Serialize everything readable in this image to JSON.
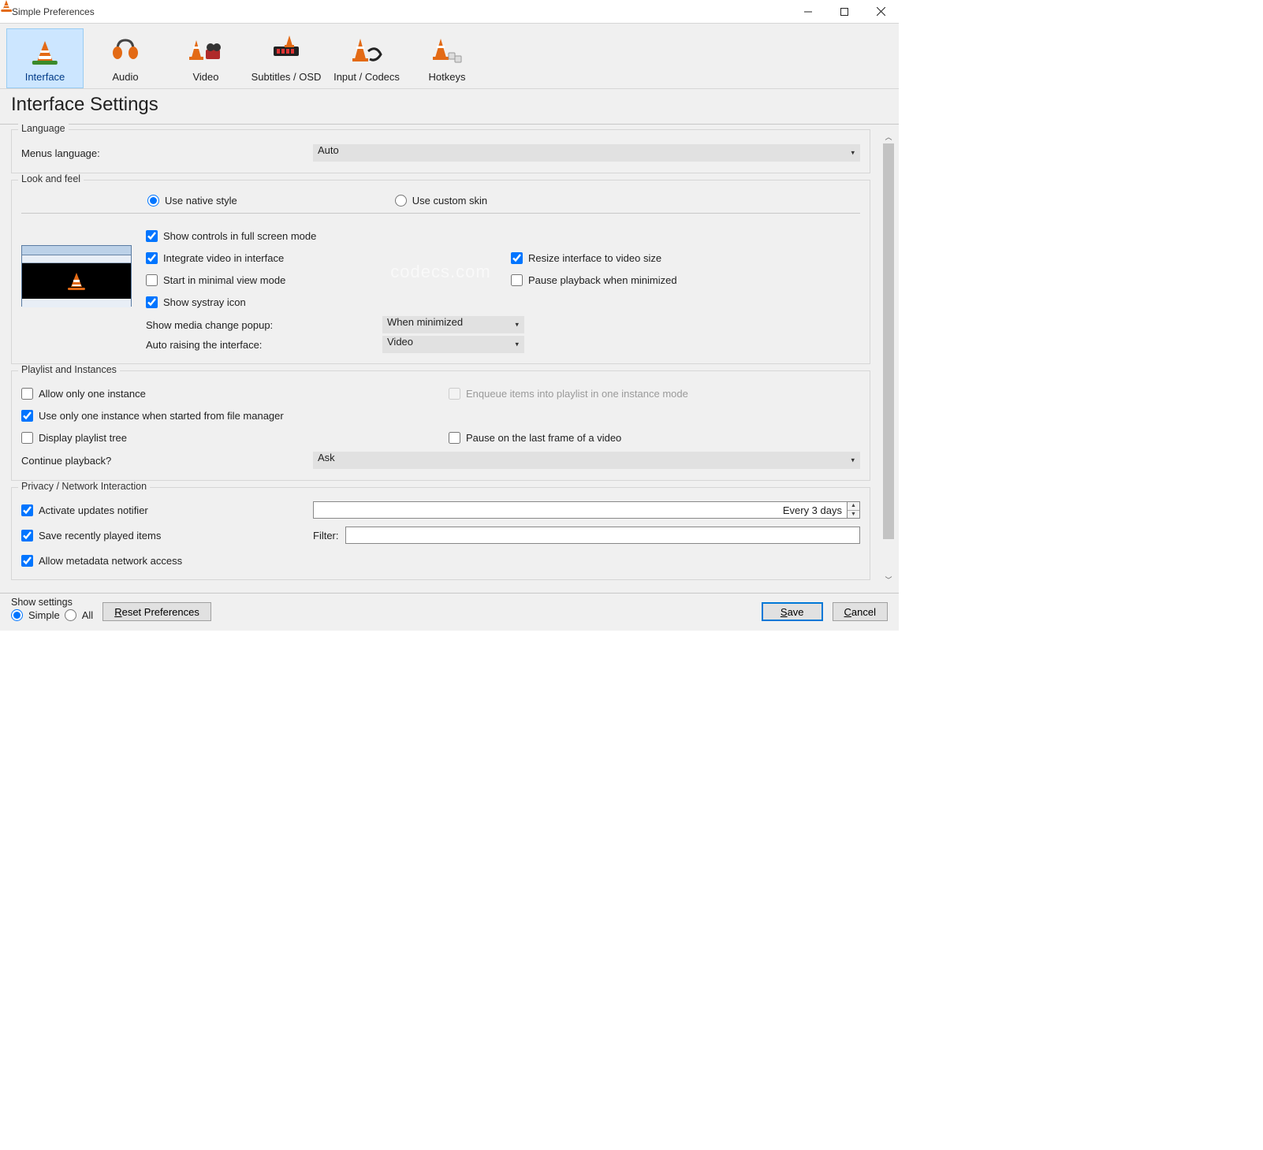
{
  "window": {
    "title": "Simple Preferences"
  },
  "tabs": [
    {
      "label": "Interface"
    },
    {
      "label": "Audio"
    },
    {
      "label": "Video"
    },
    {
      "label": "Subtitles / OSD"
    },
    {
      "label": "Input / Codecs"
    },
    {
      "label": "Hotkeys"
    }
  ],
  "page": {
    "title": "Interface Settings"
  },
  "language": {
    "legend": "Language",
    "menus_label": "Menus language:",
    "menus_value": "Auto"
  },
  "look": {
    "legend": "Look and feel",
    "native_label": "Use native style",
    "custom_label": "Use custom skin",
    "show_controls": "Show controls in full screen mode",
    "integrate_video": "Integrate video in interface",
    "resize_interface": "Resize interface to video size",
    "start_minimal": "Start in minimal view mode",
    "pause_minimized": "Pause playback when minimized",
    "show_systray": "Show systray icon",
    "media_popup_label": "Show media change popup:",
    "media_popup_value": "When minimized",
    "auto_raise_label": "Auto raising the interface:",
    "auto_raise_value": "Video"
  },
  "playlist": {
    "legend": "Playlist and Instances",
    "one_instance": "Allow only one instance",
    "enqueue": "Enqueue items into playlist in one instance mode",
    "one_instance_fm": "Use only one instance when started from file manager",
    "display_tree": "Display playlist tree",
    "pause_last_frame": "Pause on the last frame of a video",
    "continue_label": "Continue playback?",
    "continue_value": "Ask"
  },
  "privacy": {
    "legend": "Privacy / Network Interaction",
    "updates_notifier": "Activate updates notifier",
    "updates_every": "Every 3 days",
    "save_recent": "Save recently played items",
    "filter_label": "Filter:",
    "filter_value": "",
    "allow_metadata": "Allow metadata network access"
  },
  "footer": {
    "show_settings_label": "Show settings",
    "simple": "Simple",
    "all": "All",
    "reset": "Reset Preferences",
    "save": "Save",
    "cancel": "Cancel"
  },
  "watermark": "codecs.com"
}
